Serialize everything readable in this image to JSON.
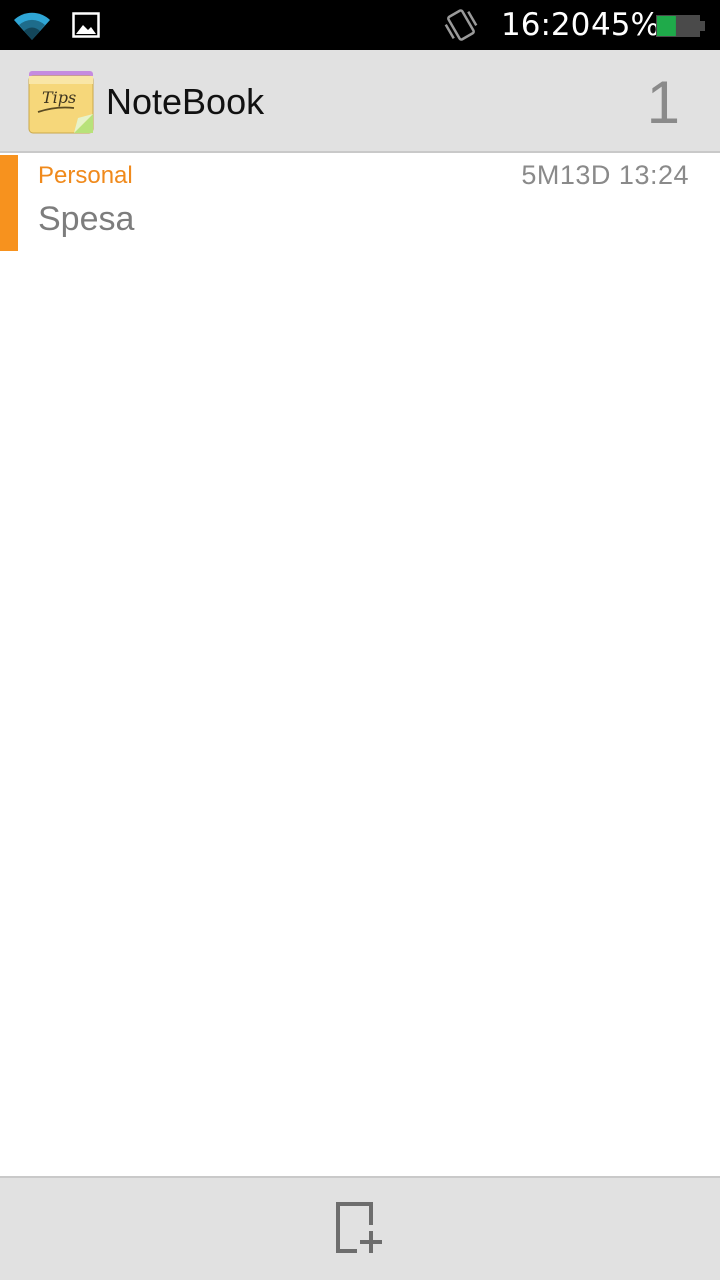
{
  "status_bar": {
    "time": "16:20",
    "battery_percent": "45%",
    "battery_level": 0.45,
    "icons": [
      "wifi-icon",
      "gallery-icon",
      "vibrate-icon",
      "battery-icon"
    ]
  },
  "action_bar": {
    "app_title": "NoteBook",
    "app_icon_text": "Tips",
    "note_count": "1"
  },
  "notes": [
    {
      "category": "Personal",
      "timestamp": "5M13D 13:24",
      "title": "Spesa",
      "color": "#f7921e"
    }
  ],
  "bottom_bar": {
    "add_icon": "add-note-icon"
  },
  "colors": {
    "accent_orange": "#f7921e",
    "bar_background": "#e1e1e1",
    "battery_green": "#1faa4a"
  }
}
